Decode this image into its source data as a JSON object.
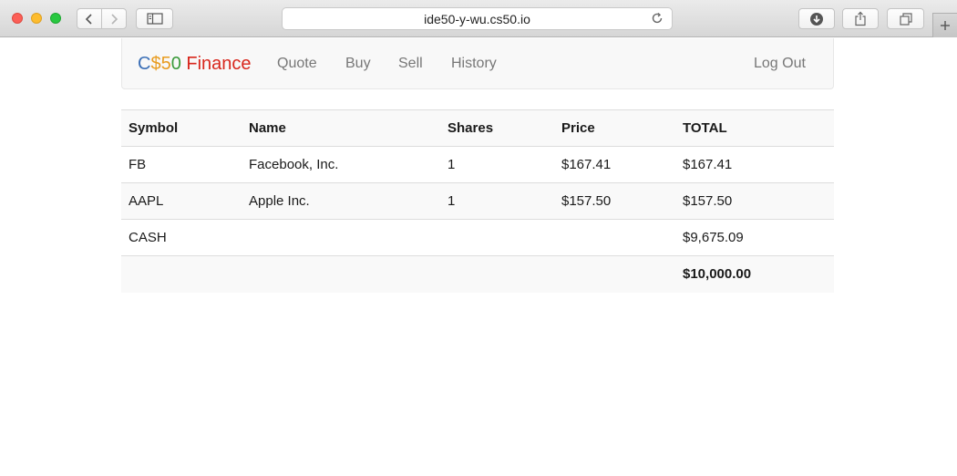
{
  "browser": {
    "url": "ide50-y-wu.cs50.io"
  },
  "icons": {
    "back": "chevron-left-icon",
    "forward": "chevron-right-icon",
    "sidebar": "sidebar-icon",
    "reload": "reload-icon",
    "download": "download-icon",
    "share": "share-icon",
    "tabs": "tabs-overview-icon",
    "new_tab": "plus-icon"
  },
  "brand": {
    "c": "C",
    "dollar": "$",
    "five": "5",
    "zero": "0",
    "finance": " Finance",
    "colors": {
      "blue": "#3b6fb6",
      "orange": "#e89b1e",
      "green": "#3a9a3a",
      "red": "#d8261c"
    }
  },
  "nav": {
    "quote": "Quote",
    "buy": "Buy",
    "sell": "Sell",
    "history": "History",
    "logout": "Log Out"
  },
  "table": {
    "headers": [
      "Symbol",
      "Name",
      "Shares",
      "Price",
      "TOTAL"
    ],
    "rows": [
      [
        "FB",
        "Facebook, Inc.",
        "1",
        "$167.41",
        "$167.41"
      ],
      [
        "AAPL",
        "Apple Inc.",
        "1",
        "$157.50",
        "$157.50"
      ],
      [
        "CASH",
        "",
        "",
        "",
        "$9,675.09"
      ]
    ],
    "footer": [
      "",
      "",
      "",
      "",
      "$10,000.00"
    ]
  }
}
